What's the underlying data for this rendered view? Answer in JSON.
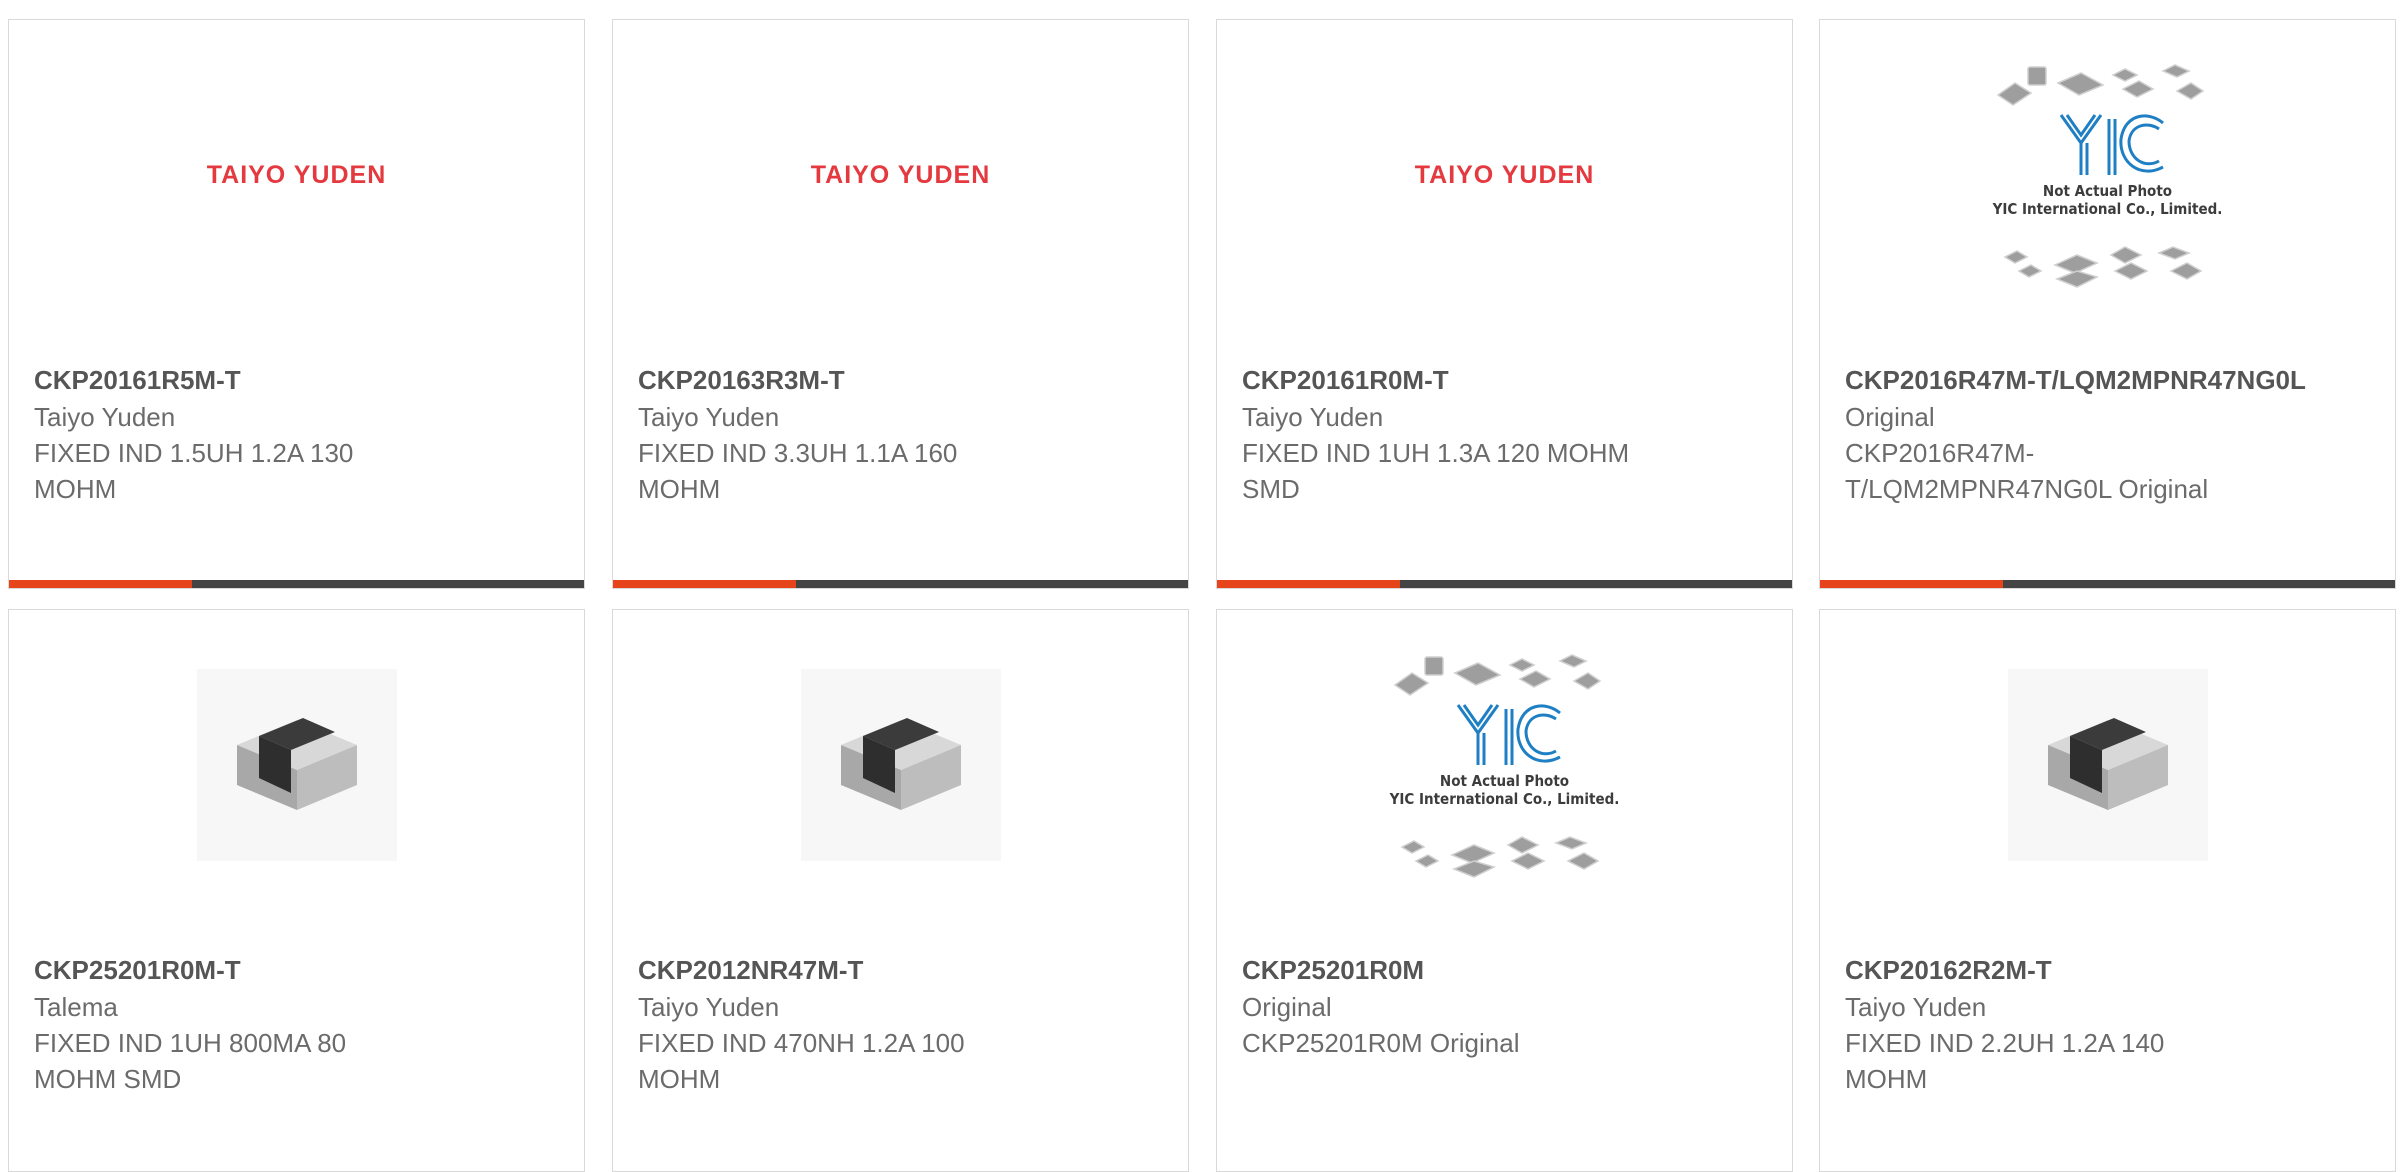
{
  "products": [
    {
      "part": "CKP20161R5M-T",
      "maker": "Taiyo Yuden",
      "desc": "FIXED IND 1.5UH 1.2A 130 MOHM",
      "image": "TAIYO YUDEN"
    },
    {
      "part": "CKP20163R3M-T",
      "maker": "Taiyo Yuden",
      "desc": "FIXED IND 3.3UH 1.1A 160 MOHM",
      "image": "TAIYO YUDEN"
    },
    {
      "part": "CKP20161R0M-T",
      "maker": "Taiyo Yuden",
      "desc": "FIXED IND 1UH 1.3A 120 MOHM SMD",
      "image": "TAIYO YUDEN"
    },
    {
      "part": "CKP2016R47M-T/LQM2MPNR47NG0L",
      "maker": "Original",
      "desc": "CKP2016R47M-T/LQM2MPNR47NG0L Original",
      "image_caption_1": "Not Actual Photo",
      "image_caption_2": "YIC International Co., Limited."
    },
    {
      "part": "CKP25201R0M-T",
      "maker": "Talema",
      "desc": "FIXED IND 1UH 800MA 80 MOHM SMD"
    },
    {
      "part": "CKP2012NR47M-T",
      "maker": "Taiyo Yuden",
      "desc": "FIXED IND 470NH 1.2A 100 MOHM"
    },
    {
      "part": "CKP25201R0M",
      "maker": "Original",
      "desc": "CKP25201R0M Original",
      "image_caption_1": "Not Actual Photo",
      "image_caption_2": "YIC International Co., Limited."
    },
    {
      "part": "CKP20162R2M-T",
      "maker": "Taiyo Yuden",
      "desc": "FIXED IND 2.2UH 1.2A 140 MOHM"
    }
  ],
  "colors": {
    "accent": "#e6441a",
    "bar": "#444444",
    "brand_red": "#e43a3f",
    "yic_blue": "#1f7fc4"
  },
  "icons": {
    "chip": "inductor-chip-image",
    "placeholder": "yic-placeholder-image"
  }
}
